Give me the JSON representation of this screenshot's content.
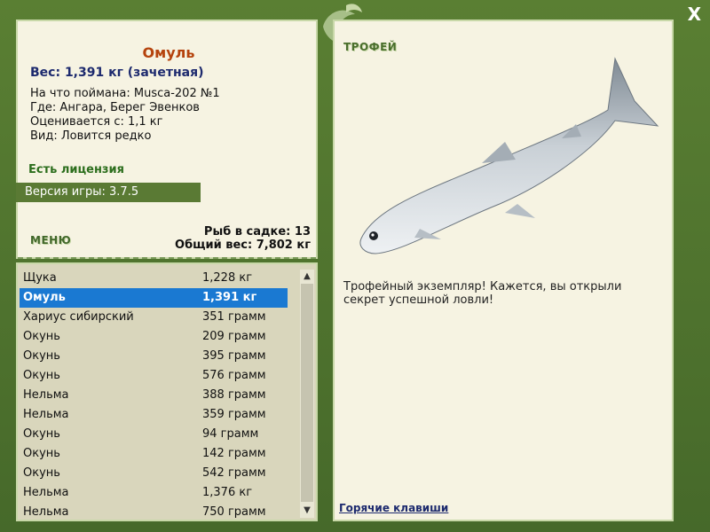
{
  "fish": {
    "name": "Омуль",
    "weight": "Вес: 1,391 кг (зачетная)",
    "caught_on": "На что поймана: Musca-202 №1",
    "where": "Где: Ангара, Берег Эвенков",
    "rated_from": "Оценивается с: 1,1 кг",
    "kind": "Вид: Ловится редко"
  },
  "license": "Есть лицензия",
  "version": "Версия игры: 3.7.5",
  "menu": "МЕНЮ",
  "stats": {
    "count": "Рыб в садке: 13",
    "total": "Общий вес: 7,802 кг"
  },
  "catch_list": [
    {
      "name": "Щука",
      "weight": "1,228 кг"
    },
    {
      "name": "Омуль",
      "weight": "1,391 кг",
      "selected": true
    },
    {
      "name": "Хариус сибирский",
      "weight": "351 грамм"
    },
    {
      "name": "Окунь",
      "weight": "209 грамм"
    },
    {
      "name": "Окунь",
      "weight": "395 грамм"
    },
    {
      "name": "Окунь",
      "weight": "576 грамм"
    },
    {
      "name": "Нельма",
      "weight": "388 грамм"
    },
    {
      "name": "Нельма",
      "weight": "359 грамм"
    },
    {
      "name": "Окунь",
      "weight": "94 грамм"
    },
    {
      "name": "Окунь",
      "weight": "142 грамм"
    },
    {
      "name": "Окунь",
      "weight": "542 грамм"
    },
    {
      "name": "Нельма",
      "weight": "1,376 кг"
    },
    {
      "name": "Нельма",
      "weight": "750 грамм"
    }
  ],
  "trophy_label": "ТРОФЕЙ",
  "trophy_text": "Трофейный экземпляр! Кажется, вы открыли секрет успешной ловли!",
  "hotkeys": "Горячие клавиши",
  "close_label": "X",
  "colors": {
    "frame": "#4a6e2c",
    "selection": "#1a79d2",
    "title": "#b5430d"
  }
}
